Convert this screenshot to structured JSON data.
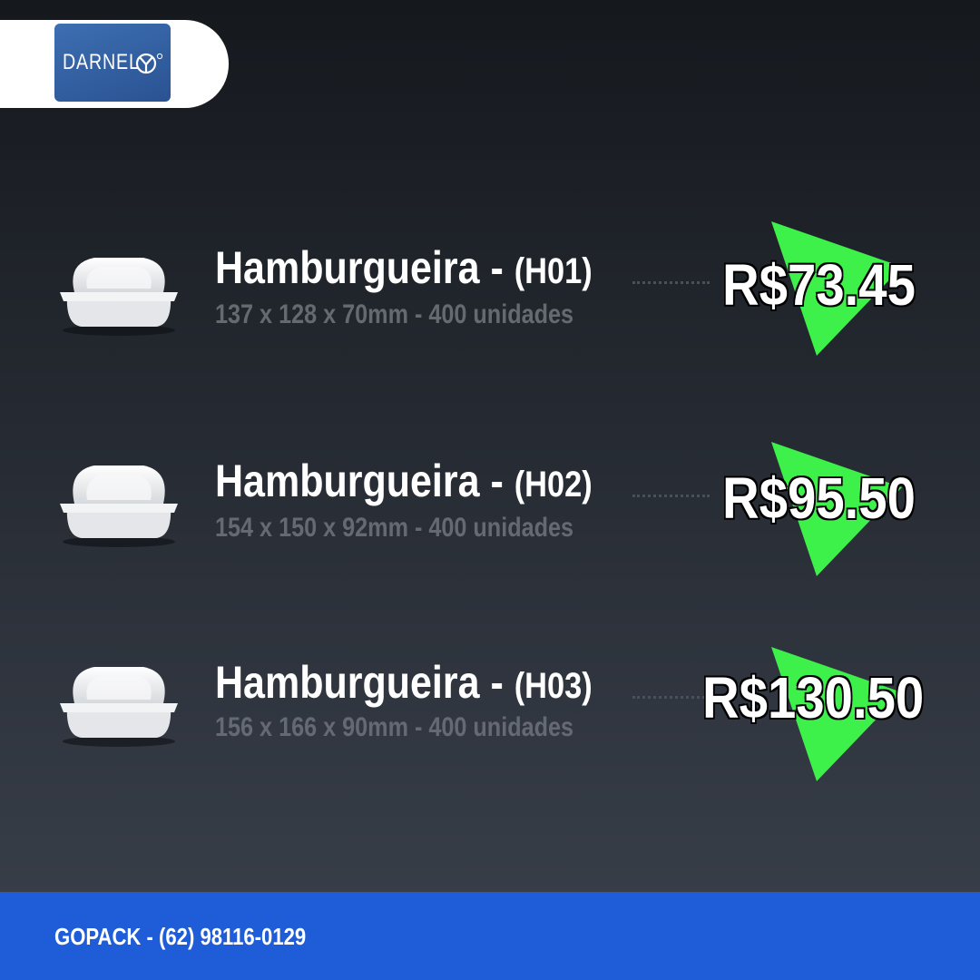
{
  "brand": {
    "logo_text": "DARNEL",
    "logo_bg": "#2f5a9c"
  },
  "products": [
    {
      "name": "Hamburgueira - ",
      "code": "(H01)",
      "dimensions": "137 x 128 x 70mm  -  400 unidades",
      "price": "R$73.45",
      "icon": "foam-clamshell-container"
    },
    {
      "name": "Hamburgueira - ",
      "code": "(H02)",
      "dimensions": "154 x 150 x 92mm  -  400 unidades",
      "price": "R$95.50",
      "icon": "foam-clamshell-container"
    },
    {
      "name": "Hamburgueira - ",
      "code": "(H03)",
      "dimensions": "156 x 166 x 90mm  -  400 unidades",
      "price": "R$130.50",
      "icon": "foam-clamshell-container"
    }
  ],
  "footer": {
    "contact": "GOPACK - (62) 98116-0129"
  },
  "colors": {
    "accent_green": "#3df04a",
    "footer_blue": "#1f5cd8",
    "background_top": "#15181d",
    "background_bottom": "#3b414c"
  }
}
